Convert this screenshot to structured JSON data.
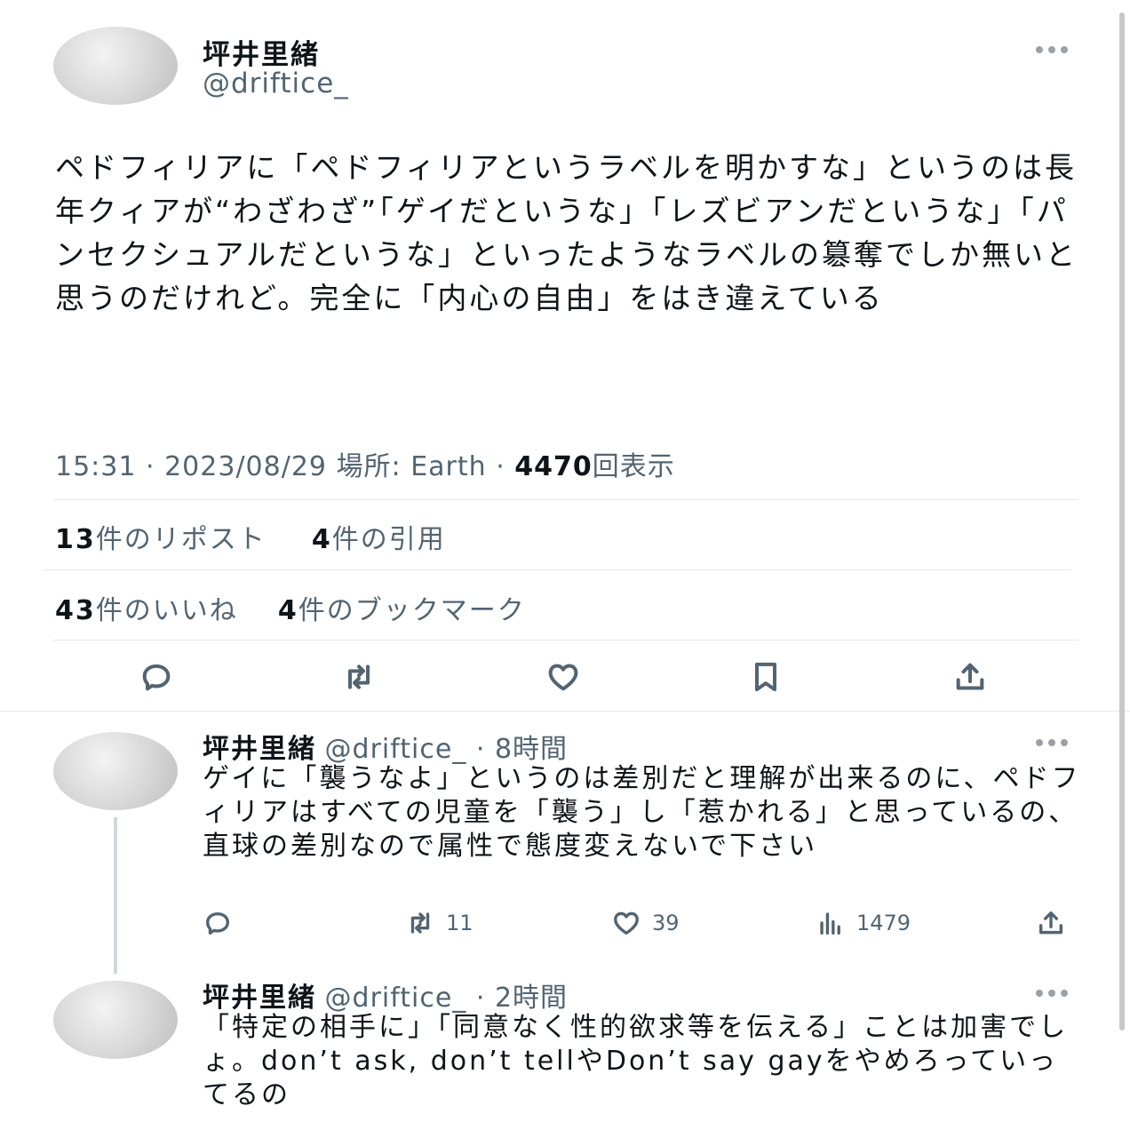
{
  "main_tweet": {
    "display_name": "坪井里緒",
    "handle": "@driftice_",
    "text": "ペドフィリアに「ペドフィリアというラベルを明かすな」というのは長年クィアが“わざわざ”「ゲイだというな」「レズビアンだというな」「パンセクシュアルだというな」といったようなラベルの簒奪でしか無いと思うのだけれど。完全に「内心の自由」をはき違えている",
    "time": "15:31",
    "date": "2023/08/29",
    "location_label": "場所: Earth",
    "views_count": "4470",
    "views_label": "回表示",
    "reposts_count": "13",
    "reposts_label": "件のリポスト",
    "quotes_count": "4",
    "quotes_label": "件の引用",
    "likes_count": "43",
    "likes_label": "件のいいね",
    "bookmarks_count": "4",
    "bookmarks_label": "件のブックマーク"
  },
  "replies": [
    {
      "display_name": "坪井里緒",
      "handle": "@driftice_",
      "age": "8時間",
      "text": "ゲイに「襲うなよ」というのは差別だと理解が出来るのに、ペドフィリアはすべての児童を「襲う」し「惹かれる」と思っているの、直球の差別なので属性で態度変えないで下さい",
      "retweets": "11",
      "likes": "39",
      "views": "1479"
    },
    {
      "display_name": "坪井里緒",
      "handle": "@driftice_",
      "age": "2時間",
      "text": "「特定の相手に」「同意なく性的欲求等を伝える」ことは加害でしょ。don’t ask, don’t tellやDon’t say gayをやめろっていってるの"
    }
  ],
  "icons": [
    "more-icon",
    "reply-icon",
    "retweet-icon",
    "like-icon",
    "bookmark-icon",
    "share-icon",
    "views-icon"
  ]
}
